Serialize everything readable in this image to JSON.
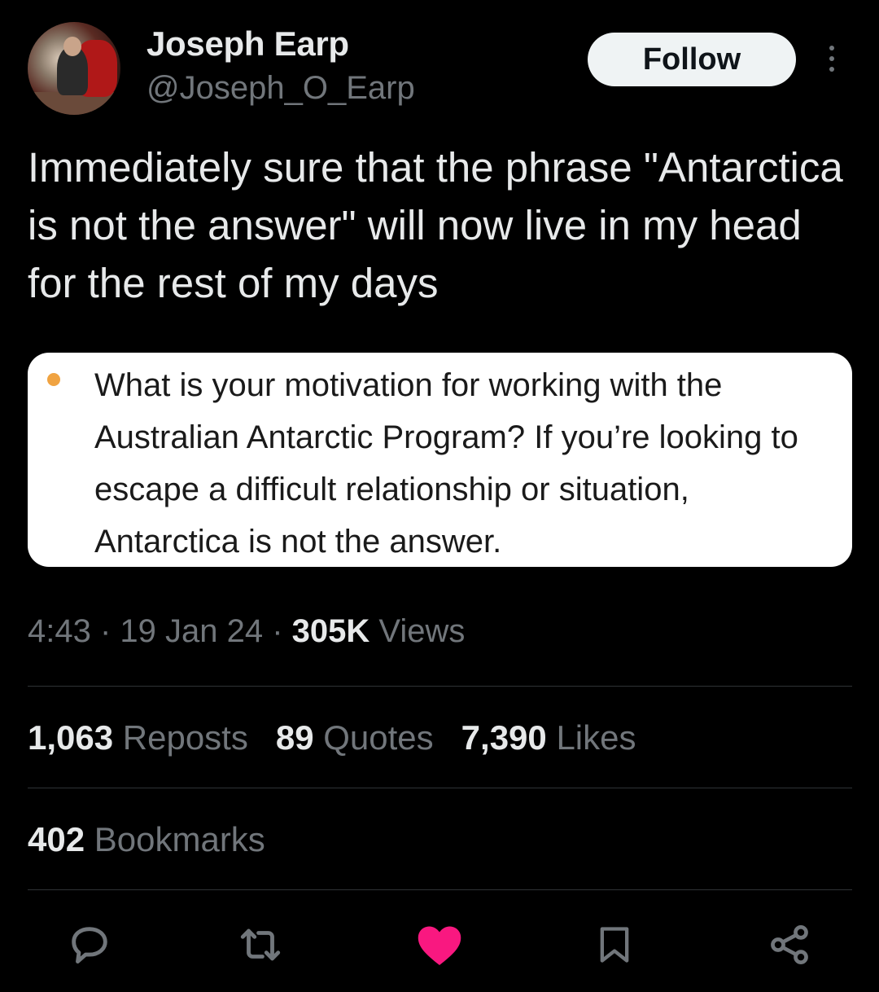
{
  "author": {
    "name": "Joseph Earp",
    "handle": "@Joseph_O_Earp"
  },
  "header": {
    "follow_label": "Follow",
    "more_icon": "more-vertical-icon"
  },
  "tweet": {
    "text": "Immediately sure that the phrase \"Antarctica is not the answer\" will now live in my head for the rest of my days",
    "quoted_image_text": "What is your motivation for working with the Australian Antarctic Program? If you’re looking to escape a difficult relationship or situation, Antarctica is not the answer.",
    "bullet_color": "#f0a341"
  },
  "meta": {
    "time": "4:43",
    "sep1": " · ",
    "date": "19 Jan 24",
    "sep2": " · ",
    "views_count": "305K",
    "views_label": " Views"
  },
  "stats": {
    "reposts_count": "1,063",
    "reposts_label": " Reposts",
    "quotes_count": "89",
    "quotes_label": " Quotes",
    "likes_count": "7,390",
    "likes_label": " Likes",
    "bookmarks_count": "402",
    "bookmarks_label": " Bookmarks"
  },
  "actions": {
    "icons": [
      "reply-icon",
      "repost-icon",
      "like-icon",
      "bookmark-icon",
      "share-icon"
    ],
    "like_color": "#f91880"
  },
  "colors": {
    "background": "#000000",
    "text_primary": "#e7e9ea",
    "text_secondary": "#71767b",
    "divider": "#2f3336"
  }
}
